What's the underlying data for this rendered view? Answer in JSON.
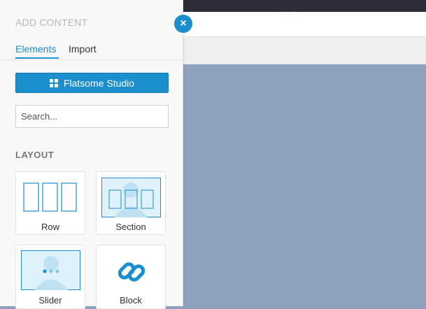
{
  "panel": {
    "title": "ADD CONTENT",
    "tabs": [
      {
        "label": "Elements",
        "active": true
      },
      {
        "label": "Import",
        "active": false
      }
    ],
    "studio_button": {
      "label": "Flatsome Studio",
      "icon": "grid-icon"
    },
    "search": {
      "placeholder": "Search...",
      "value": ""
    },
    "section_title": "LAYOUT",
    "elements": [
      {
        "label": "Row",
        "icon": "row-columns-icon"
      },
      {
        "label": "Section",
        "icon": "section-icon"
      },
      {
        "label": "Slider",
        "icon": "slider-icon"
      },
      {
        "label": "Block",
        "icon": "link-chain-icon"
      }
    ]
  },
  "close_button": {
    "icon": "close-icon",
    "glyph": "×"
  },
  "colors": {
    "accent": "#1b8ecd",
    "panel_bg": "#f8f8f8",
    "canvas_bg": "#8ea2be",
    "topbar": "#2b2d36"
  }
}
